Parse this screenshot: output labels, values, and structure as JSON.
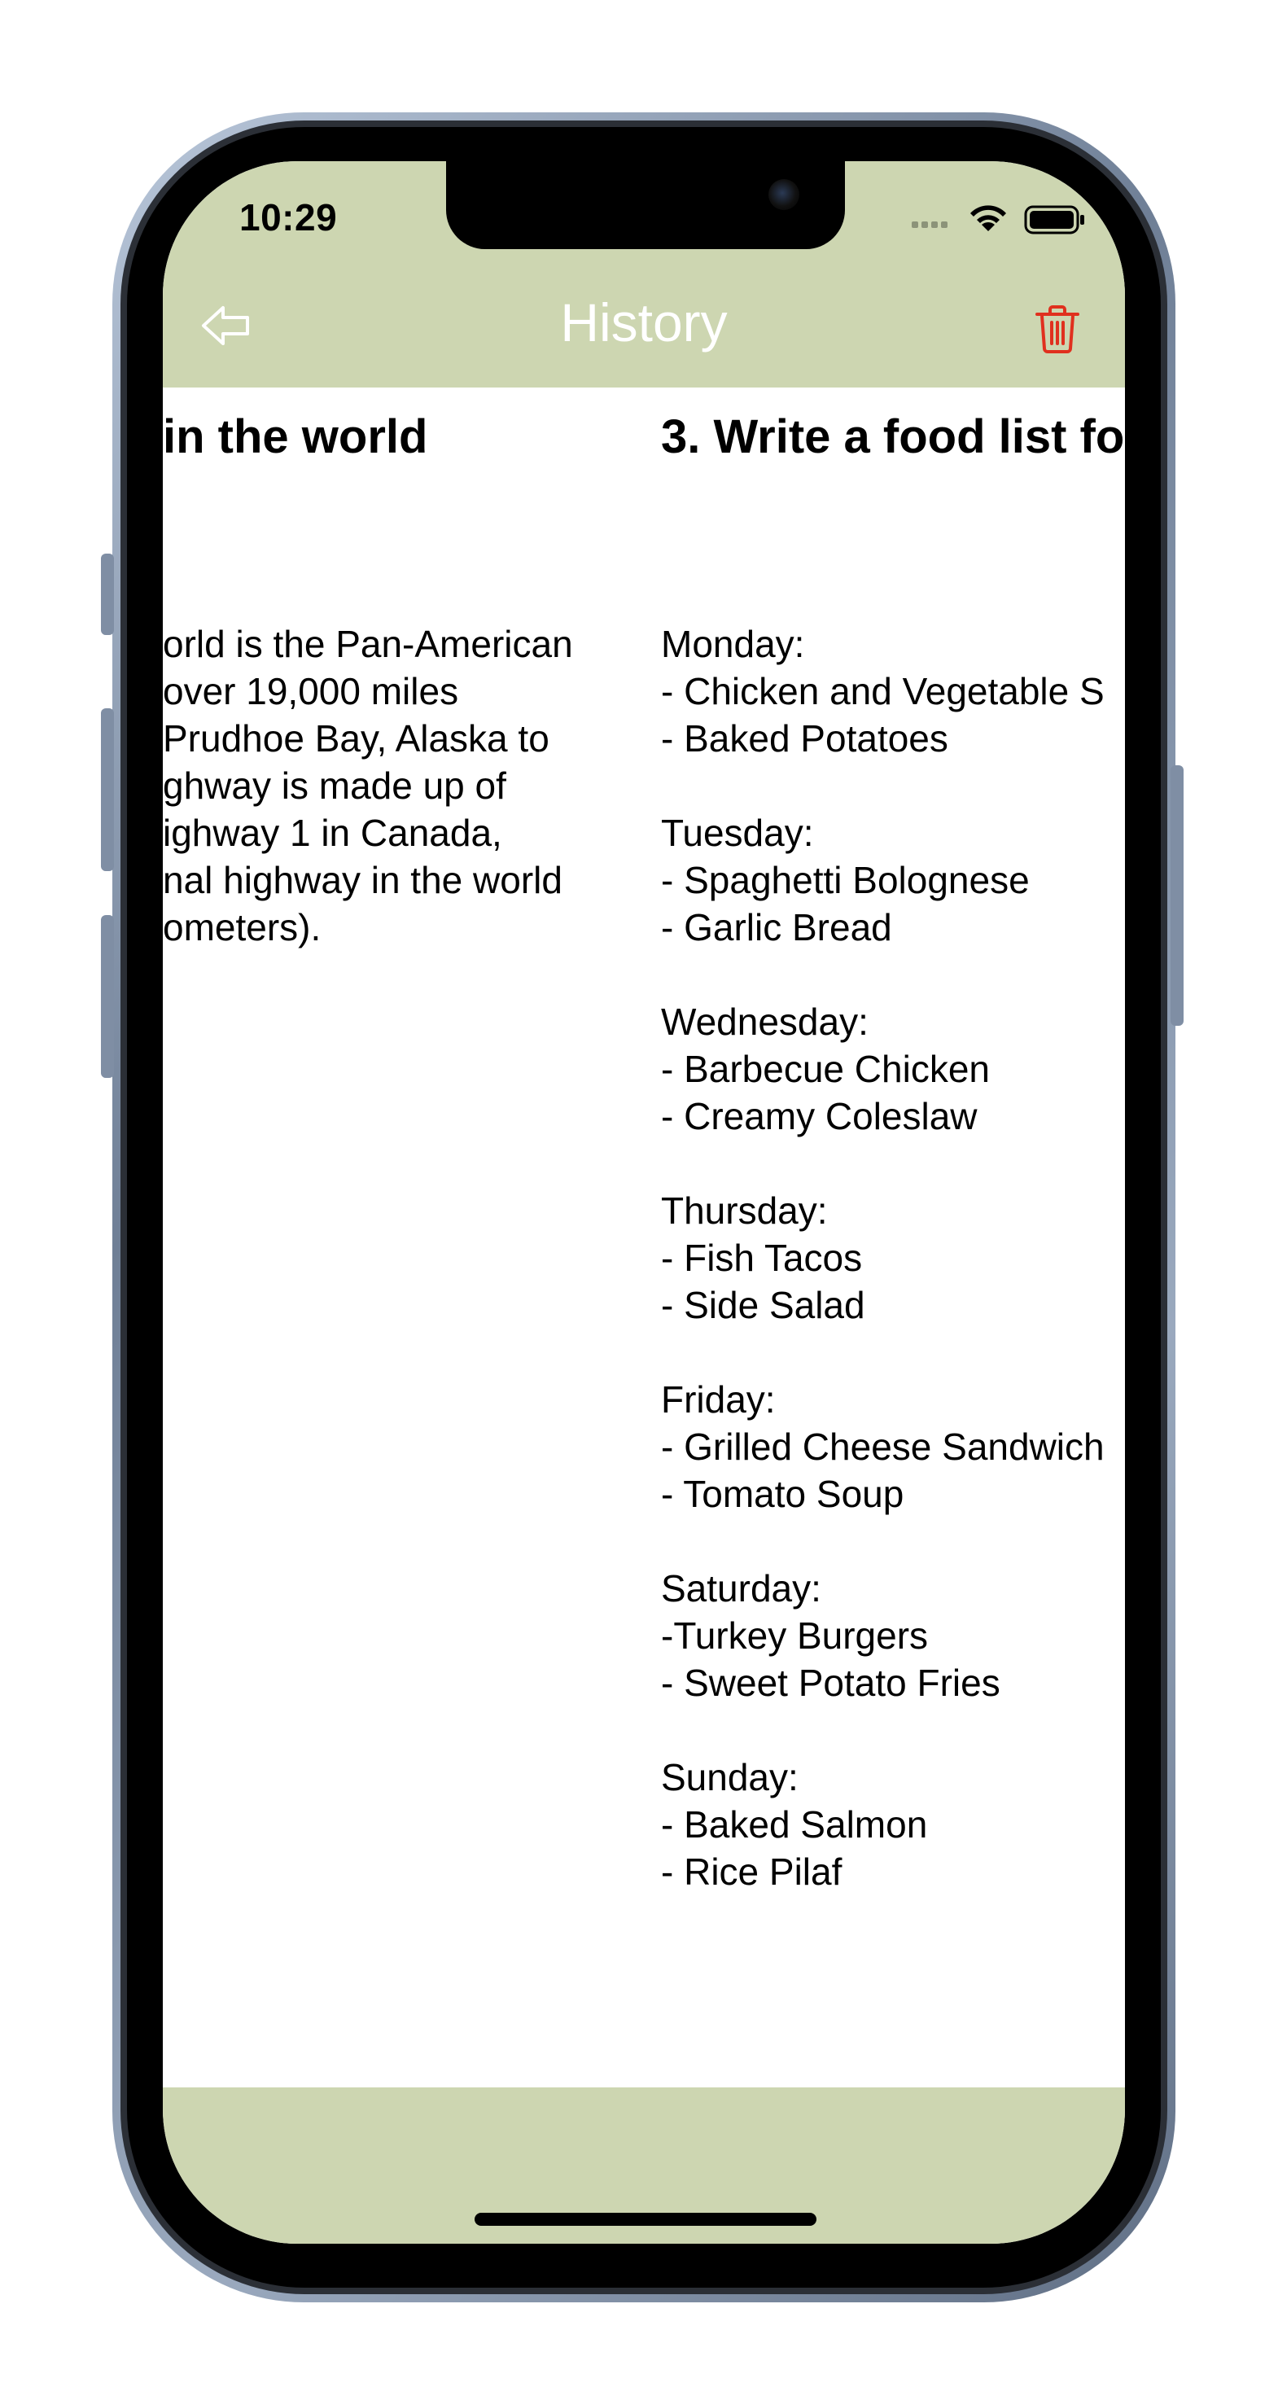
{
  "status_bar": {
    "time": "10:29"
  },
  "nav": {
    "title": "History",
    "back_icon": "arrow-left-outline-icon",
    "delete_icon": "trash-icon"
  },
  "cards": [
    {
      "title": "...rgest highway in the world",
      "visible_title": "in the world",
      "body_lines": [
        "orld is the Pan-American",
        "over 19,000 miles",
        "Prudhoe Bay, Alaska to",
        "ghway is made up of",
        "ighway 1 in Canada,",
        "nal highway in the world",
        "ometers)."
      ]
    },
    {
      "title": "3. Write a food list fo",
      "body_lines": [
        "Monday:",
        "- Chicken and Vegetable S",
        "- Baked Potatoes",
        "",
        "Tuesday:",
        "- Spaghetti Bolognese",
        "- Garlic Bread",
        "",
        "Wednesday:",
        "- Barbecue Chicken",
        "- Creamy Coleslaw",
        "",
        "Thursday:",
        "- Fish Tacos",
        "- Side Salad",
        "",
        "Friday:",
        "- Grilled Cheese Sandwich",
        "- Tomato Soup",
        "",
        "Saturday:",
        "-Turkey Burgers",
        "- Sweet Potato Fries",
        "",
        "Sunday:",
        "- Baked Salmon",
        "- Rice Pilaf"
      ]
    }
  ],
  "colors": {
    "bar_background": "#cdd6b1",
    "nav_title": "#ffffff",
    "delete_icon": "#e0301e"
  }
}
